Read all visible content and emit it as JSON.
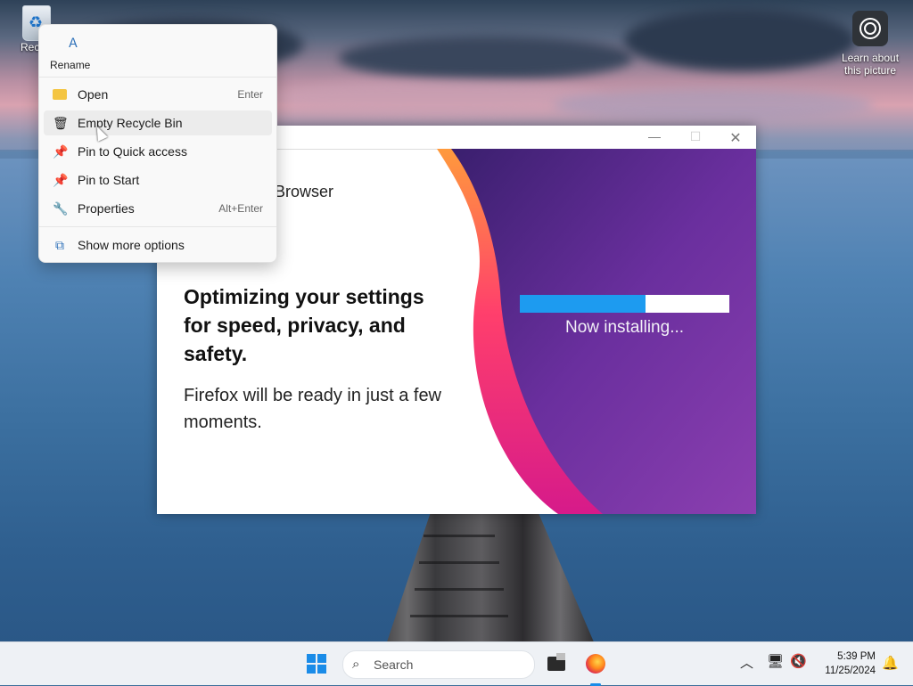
{
  "desktop": {
    "recycle_label": "Recycl",
    "learn_label": "Learn about this picture"
  },
  "installer": {
    "brand_text": "Browser",
    "headline": "Optimizing your settings for speed, privacy, and safety.",
    "subtext": "Firefox will be ready in just a few moments.",
    "progress_fraction": 0.6,
    "progress_label": "Now installing...",
    "title_buttons": {
      "minimize": "—",
      "maximize": "☐",
      "close": "✕"
    }
  },
  "context_menu": {
    "top_action": {
      "label": "Rename",
      "icon": "rename-icon"
    },
    "items": [
      {
        "label": "Open",
        "shortcut": "Enter",
        "icon": "folder-icon"
      },
      {
        "label": "Empty Recycle Bin",
        "shortcut": "",
        "icon": "trash-icon"
      },
      {
        "label": "Pin to Quick access",
        "shortcut": "",
        "icon": "pin-icon"
      },
      {
        "label": "Pin to Start",
        "shortcut": "",
        "icon": "pin-icon"
      },
      {
        "label": "Properties",
        "shortcut": "Alt+Enter",
        "icon": "wrench-icon"
      },
      {
        "label": "Show more options",
        "shortcut": "",
        "icon": "more-options-icon"
      }
    ]
  },
  "taskbar": {
    "search_placeholder": "Search",
    "time": "5:39 PM",
    "date": "11/25/2024"
  },
  "colors": {
    "accent": "#1a8ce8",
    "progress_fill": "#1d9bf0"
  }
}
